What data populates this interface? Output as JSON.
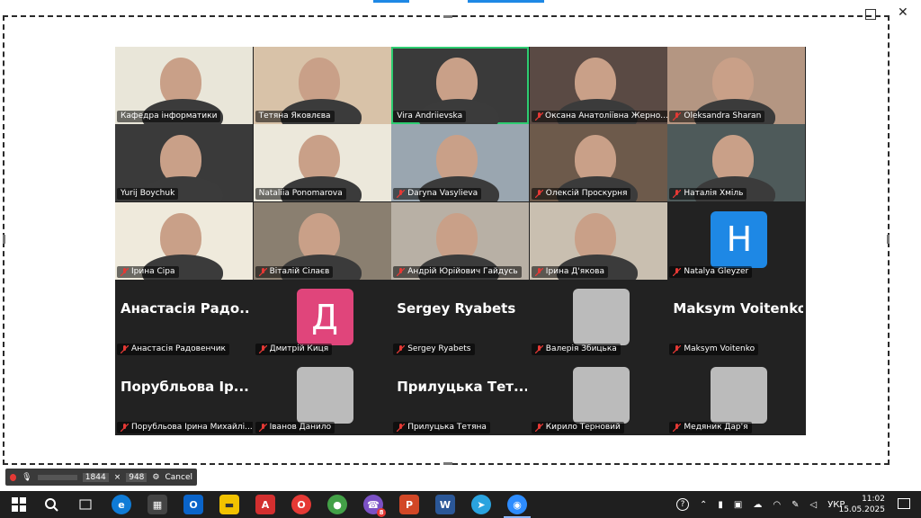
{
  "window_controls": [
    "restore",
    "close"
  ],
  "participants": [
    {
      "name": "Кафедра інформатики",
      "type": "video",
      "muted": false
    },
    {
      "name": "Тетяна Яковлєва",
      "type": "video",
      "muted": false
    },
    {
      "name": "Vira Andriievska",
      "type": "video",
      "muted": false,
      "active_speaker": true
    },
    {
      "name": "Оксана Анатоліївна Жерно...",
      "type": "video",
      "muted": true
    },
    {
      "name": "Oleksandra Sharan",
      "type": "video",
      "muted": true
    },
    {
      "name": "Yurij Boychuk",
      "type": "video",
      "muted": false
    },
    {
      "name": "Nataliia Ponomarova",
      "type": "video",
      "muted": false
    },
    {
      "name": "Daryna Vasylieva",
      "type": "video",
      "muted": true
    },
    {
      "name": "Олексій Проскурня",
      "type": "video",
      "muted": true
    },
    {
      "name": "Наталія Хміль",
      "type": "video",
      "muted": true
    },
    {
      "name": "Ірина Сіра",
      "type": "video",
      "muted": true
    },
    {
      "name": "Віталій Сілаєв",
      "type": "video",
      "muted": true
    },
    {
      "name": "Андрій Юрійович Гайдусь",
      "type": "video",
      "muted": true
    },
    {
      "name": "Ірина Д'якова",
      "type": "video",
      "muted": true
    },
    {
      "name": "Natalya Gleyzer",
      "type": "letter",
      "letter": "H",
      "color": "#1e88e5",
      "muted": true
    },
    {
      "name": "Анастасія Радовенчик",
      "display": "Анастасія Радо...",
      "type": "text",
      "muted": true
    },
    {
      "name": "Дмитрій Киця",
      "type": "letter",
      "letter": "Д",
      "color": "#e0457b",
      "muted": true
    },
    {
      "name": "Sergey Ryabets",
      "display": "Sergey Ryabets",
      "type": "text",
      "muted": true
    },
    {
      "name": "Валерія Збицька",
      "type": "photo",
      "muted": true
    },
    {
      "name": "Maksym Voitenko",
      "display": "Maksym Voitenko",
      "type": "text",
      "muted": true
    },
    {
      "name": "Порубльова Ірина Михайлі...",
      "display": "Порубльова Ір...",
      "type": "text",
      "muted": true
    },
    {
      "name": "Іванов Данило",
      "type": "photo",
      "muted": true
    },
    {
      "name": "Прилуцька Тетяна",
      "display": "Прилуцька Тет...",
      "type": "text",
      "muted": true
    },
    {
      "name": "Кирило Терновий",
      "type": "photo",
      "muted": true
    },
    {
      "name": "Медяник Дар'я",
      "type": "photo",
      "muted": true
    }
  ],
  "recording_bar": {
    "width": "1844",
    "height": "948",
    "cancel": "Cancel"
  },
  "taskbar": {
    "apps": [
      "start",
      "search",
      "task-view",
      "edge",
      "store",
      "outlook",
      "file-explorer",
      "acrobat",
      "opera",
      "chrome",
      "viber",
      "powerpoint",
      "word",
      "telegram",
      "zoom"
    ],
    "viber_badge": "8",
    "language": "УКР",
    "time": "11:02",
    "date": "15.05.2025"
  }
}
